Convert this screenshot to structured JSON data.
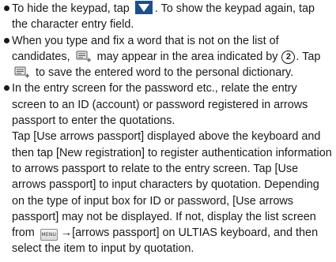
{
  "items": [
    {
      "lead": "To hide the keypad, tap ",
      "mid": ". To show the keypad again, tap the character entry field."
    },
    {
      "a": "When you type and fix a word that is not on the list of candidates, ",
      "b": " may appear in the area indicated by ",
      "circled": "2",
      "c": ". Tap ",
      "d": " to save the entered word to the personal dictionary."
    },
    {
      "p1": "In the entry screen for the password etc., relate the entry screen to an ID (account) or password registered in arrows passport to enter the quotations.",
      "p2": "Tap [Use arrows passport] displayed above the keyboard and then tap [New registration] to register authentication information to arrows passport to relate to the entry screen. Tap [Use arrows passport] to input characters by quotation. Depending on the type of input box for ID or password, [Use arrows passport] may not be displayed. If not, display the list screen from ",
      "menu_key_label": "MENU",
      "p3": "→[arrows passport] on ULTIAS keyboard, and then select the item to input by quotation."
    }
  ],
  "icons": {
    "hide_keypad": "down-triangle-icon",
    "dictionary": "dictionary-add-icon",
    "menu": "menu-key-icon"
  },
  "colors": {
    "icon_blue": "#1f4e8c",
    "text": "#1a1a1a"
  }
}
